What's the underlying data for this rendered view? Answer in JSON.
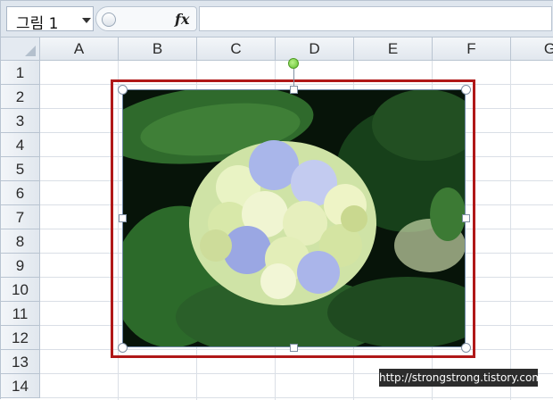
{
  "formula_bar": {
    "name_box": "그림 1",
    "fx_label": "fx",
    "formula_value": ""
  },
  "columns": [
    "A",
    "B",
    "C",
    "D",
    "E",
    "F",
    "G"
  ],
  "rows": [
    "1",
    "2",
    "3",
    "4",
    "5",
    "6",
    "7",
    "8",
    "9",
    "10",
    "11",
    "12",
    "13",
    "14"
  ],
  "picture": {
    "subject": "blue hydrangea flower with green leaves",
    "highlight_color": "#b01818"
  },
  "watermark": "http://strongstrong.tistory.com"
}
